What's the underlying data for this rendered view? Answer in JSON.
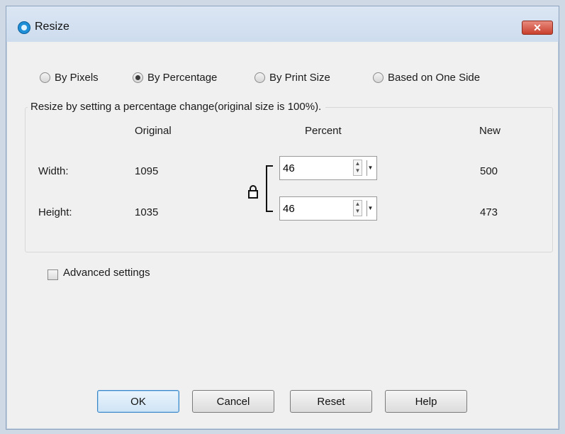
{
  "window": {
    "title": "Resize",
    "close_label": "✕"
  },
  "modes": [
    {
      "label": "By Pixels",
      "checked": false
    },
    {
      "label": "By Percentage",
      "checked": true
    },
    {
      "label": "By Print Size",
      "checked": false
    },
    {
      "label": "Based on One Side",
      "checked": false
    }
  ],
  "group": {
    "legend": "Resize by setting a percentage change(original size is 100%).",
    "headers": {
      "original": "Original",
      "percent": "Percent",
      "new": "New"
    },
    "rows": [
      {
        "label": "Width:",
        "original": "1095",
        "percent": "46",
        "new": "500"
      },
      {
        "label": "Height:",
        "original": "1035",
        "percent": "46",
        "new": "473"
      }
    ]
  },
  "advanced": {
    "label": "Advanced settings",
    "checked": false
  },
  "buttons": {
    "ok": "OK",
    "cancel": "Cancel",
    "reset": "Reset",
    "help": "Help"
  }
}
